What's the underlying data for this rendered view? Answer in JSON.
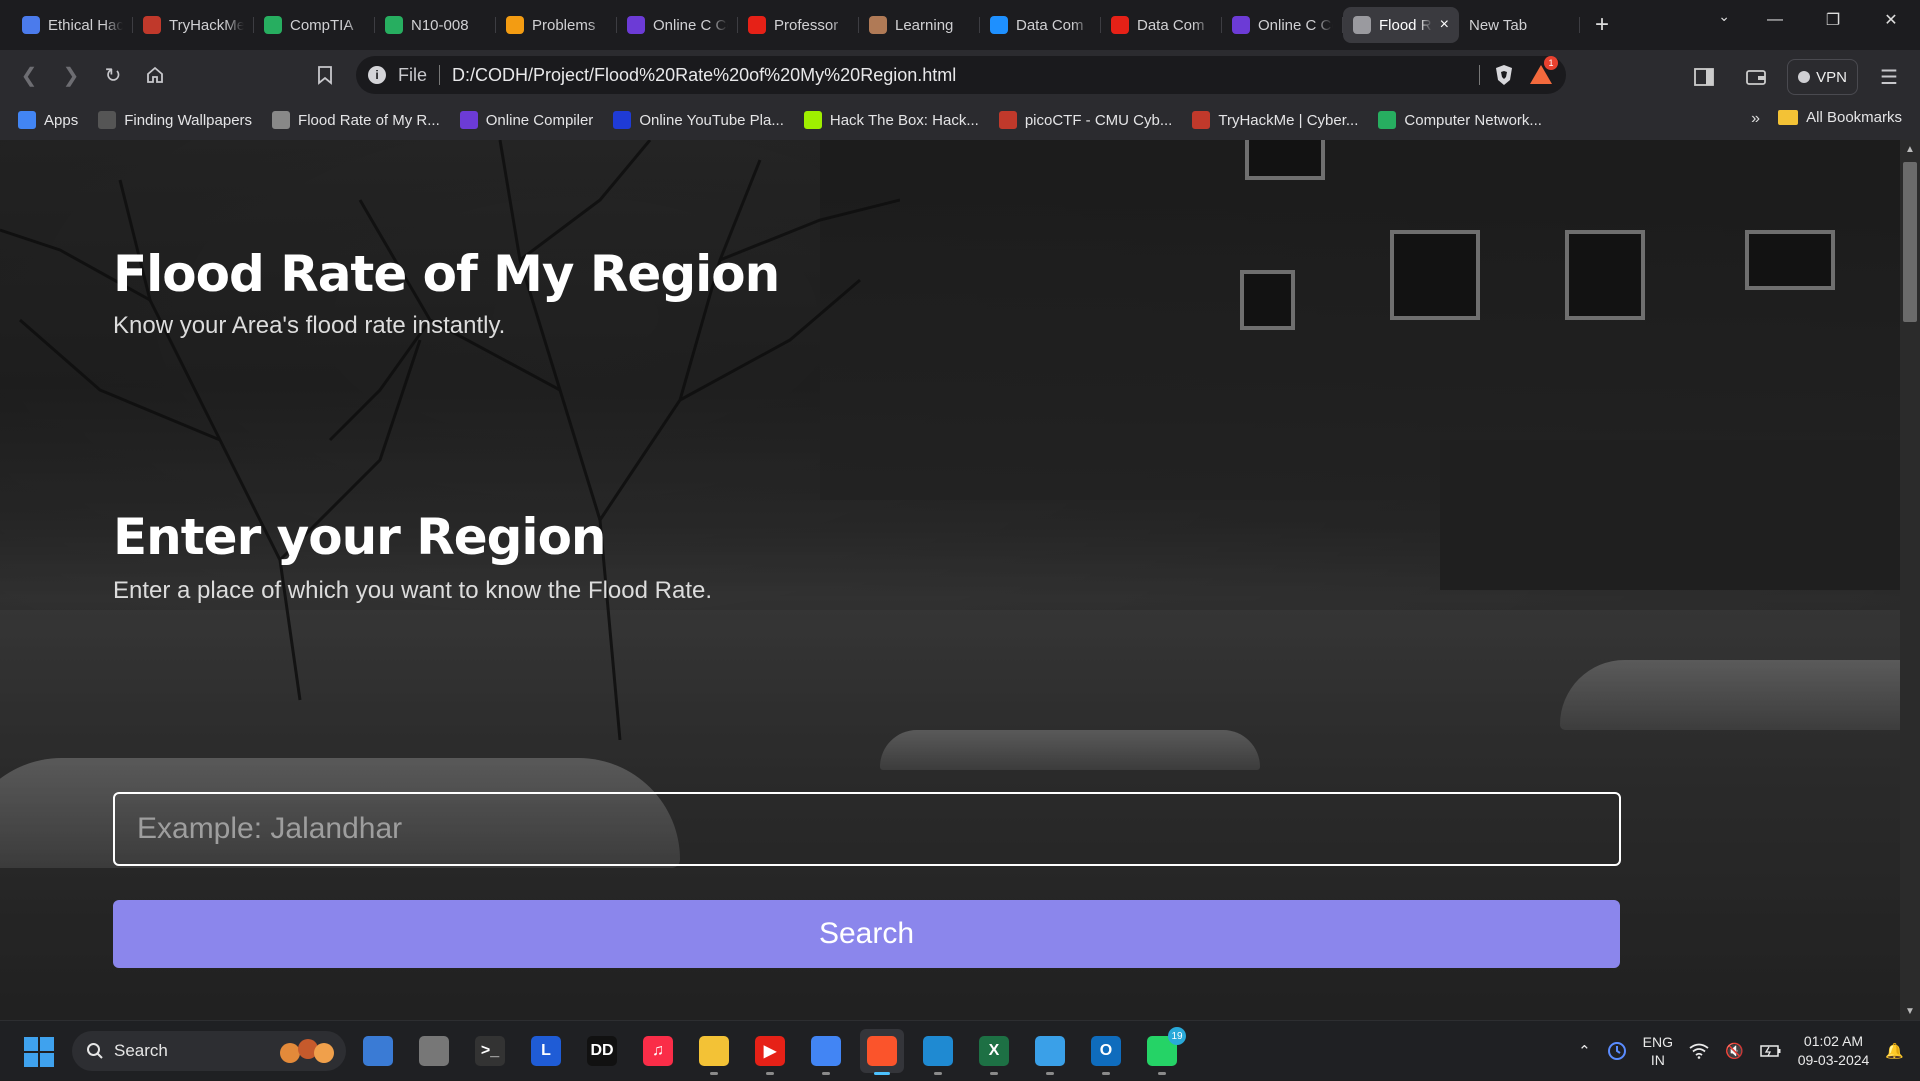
{
  "browser": {
    "tabs": [
      {
        "label": "Ethical Hacking",
        "icon": "doc-icon",
        "color": "#4b7bec"
      },
      {
        "label": "TryHackMe",
        "icon": "tryhackme-icon",
        "color": "#c0392b"
      },
      {
        "label": "CompTIA",
        "icon": "comptia-icon",
        "color": "#27ae60"
      },
      {
        "label": "N10-008",
        "icon": "comptia-icon",
        "color": "#27ae60"
      },
      {
        "label": "Problems",
        "icon": "problems-icon",
        "color": "#f39c12"
      },
      {
        "label": "Online C Compiler",
        "icon": "programiz-icon",
        "color": "#6c3bd6"
      },
      {
        "label": "Professor",
        "icon": "youtube-icon",
        "color": "#e62117"
      },
      {
        "label": "Learning",
        "icon": "learning-icon",
        "color": "#b07a56"
      },
      {
        "label": "Data Com",
        "icon": "paypal-icon",
        "color": "#1e90ff"
      },
      {
        "label": "Data Com",
        "icon": "youtube-icon",
        "color": "#e62117"
      },
      {
        "label": "Online C Compiler",
        "icon": "programiz-icon",
        "color": "#6c3bd6"
      },
      {
        "label": "Flood Rate of My Region",
        "icon": "globe-icon",
        "color": "#9a9a9f",
        "active": true
      },
      {
        "label": "New Tab",
        "icon": "",
        "color": ""
      }
    ],
    "address": {
      "scheme": "File",
      "url": "D:/CODH/Project/Flood%20Rate%20of%20My%20Region.html",
      "rewards_count": "1"
    },
    "vpn_label": "VPN",
    "bookmarks": [
      {
        "label": "Apps",
        "icon": "apps-grid-icon",
        "color": "#4285f4"
      },
      {
        "label": "Finding Wallpapers",
        "icon": "wallpaper-icon",
        "color": "#555"
      },
      {
        "label": "Flood Rate of My R...",
        "icon": "globe-icon",
        "color": "#888"
      },
      {
        "label": "Online Compiler",
        "icon": "programiz-icon",
        "color": "#6c3bd6"
      },
      {
        "label": "Online YouTube Pla...",
        "icon": "ten-icon",
        "color": "#1f3bd6"
      },
      {
        "label": "Hack The Box: Hack...",
        "icon": "htb-icon",
        "color": "#9fef00"
      },
      {
        "label": "picoCTF - CMU Cyb...",
        "icon": "picoctf-icon",
        "color": "#c0392b"
      },
      {
        "label": "TryHackMe | Cyber...",
        "icon": "tryhackme-icon",
        "color": "#c0392b"
      },
      {
        "label": "Computer Network...",
        "icon": "network-icon",
        "color": "#27ae60"
      }
    ],
    "all_bookmarks_label": "All Bookmarks"
  },
  "page": {
    "hero_title": "Flood Rate of My Region",
    "hero_subtitle": "Know your Area's flood rate instantly.",
    "region_title": "Enter your Region",
    "region_subtitle": "Enter a place of which you want to know the Flood Rate.",
    "region_input_placeholder": "Example: Jalandhar",
    "search_button_label": "Search"
  },
  "taskbar": {
    "search_label": "Search",
    "apps": [
      {
        "name": "copilot-icon",
        "color": "#3a7bd5",
        "label": ""
      },
      {
        "name": "task-view-icon",
        "color": "#777",
        "label": ""
      },
      {
        "name": "terminal-icon",
        "color": "#333",
        "label": ">_"
      },
      {
        "name": "l-app-icon",
        "color": "#1f5cd6",
        "label": "L"
      },
      {
        "name": "dolby-icon",
        "color": "#111",
        "label": "DD"
      },
      {
        "name": "music-icon",
        "color": "#fa2d48",
        "label": "♫"
      },
      {
        "name": "file-explorer-icon",
        "color": "#f3c236",
        "label": ""
      },
      {
        "name": "youtube-icon",
        "color": "#e62117",
        "label": "▶"
      },
      {
        "name": "chrome-icon",
        "color": "#4285f4",
        "label": ""
      },
      {
        "name": "brave-icon",
        "color": "#fb542b",
        "label": "",
        "active": true
      },
      {
        "name": "vscode-icon",
        "color": "#1f8ad2",
        "label": ""
      },
      {
        "name": "excel-icon",
        "color": "#1d7044",
        "label": "X"
      },
      {
        "name": "notepad-icon",
        "color": "#3aa0e8",
        "label": ""
      },
      {
        "name": "outlook-icon",
        "color": "#0f6cbd",
        "label": "O"
      },
      {
        "name": "whatsapp-icon",
        "color": "#25d366",
        "label": "",
        "badge": "19"
      }
    ],
    "tray": {
      "lang_top": "ENG",
      "lang_bottom": "IN",
      "time": "01:02 AM",
      "date": "09-03-2024"
    }
  }
}
